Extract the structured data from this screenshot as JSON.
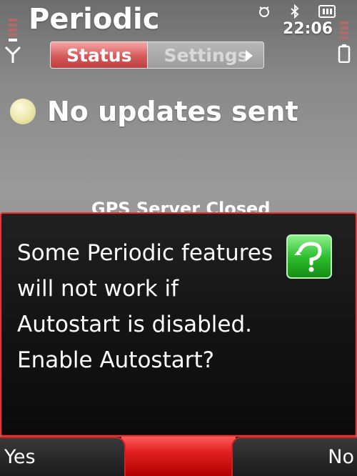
{
  "app": {
    "title": "Periodic"
  },
  "status_bar": {
    "clock": "22:06",
    "icons": [
      "signal-icon",
      "alarm-icon",
      "bluetooth-icon",
      "keypad-icon",
      "battery-icon"
    ]
  },
  "tabs": [
    {
      "label": "Status",
      "active": true
    },
    {
      "label": "Settings",
      "active": false
    }
  ],
  "main": {
    "status_text": "No updates sent",
    "gps_text": "GPS Server Closed"
  },
  "dialog": {
    "message": "Some Periodic features will not work if Autostart is disabled. Enable Autostart?",
    "icon": "query-icon"
  },
  "softkeys": {
    "left": "Yes",
    "right": "No"
  },
  "colors": {
    "accent": "#d83a3a",
    "tab_active": "#d55a5a",
    "status_dot": "#ece7a9",
    "query_icon": "#33cc33"
  }
}
